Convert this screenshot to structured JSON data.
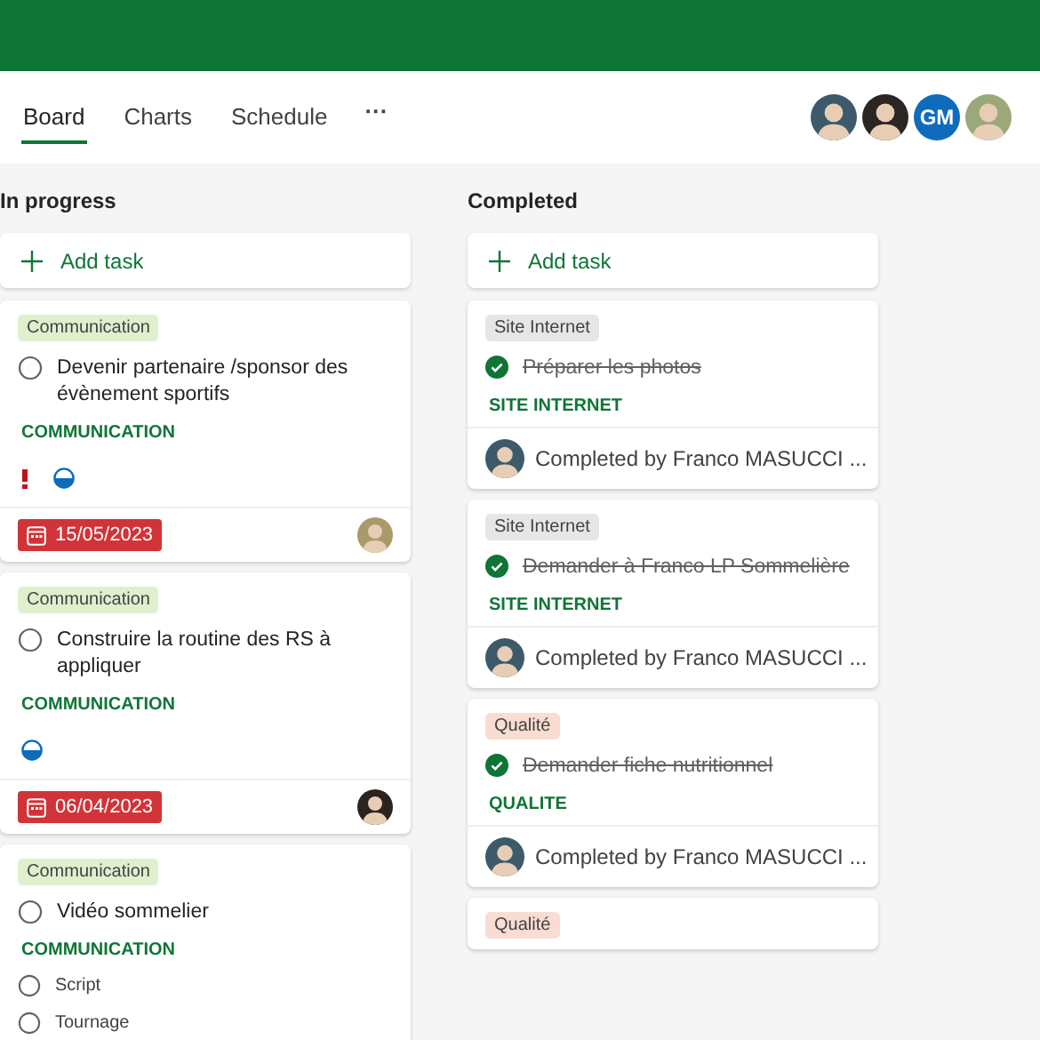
{
  "tabs": [
    {
      "label": "Board",
      "selected": true
    },
    {
      "label": "Charts",
      "selected": false
    },
    {
      "label": "Schedule",
      "selected": false
    }
  ],
  "more": "···",
  "members": [
    {
      "kind": "photo",
      "color": "#3d5a6b"
    },
    {
      "kind": "photo",
      "color": "#2b2523"
    },
    {
      "kind": "initials",
      "initials": "GM",
      "color": "#0f6cbd"
    },
    {
      "kind": "photo",
      "color": "#9aa87a"
    }
  ],
  "columns": [
    {
      "title": "In progress",
      "add_label": "Add task",
      "cards": [
        {
          "label": {
            "text": "Communication",
            "color": "#dff0cf"
          },
          "title": "Devenir partenaire /sponsor des évènement sportifs",
          "completed": false,
          "bucket": "COMMUNICATION",
          "urgent": true,
          "in_progress": true,
          "due_date": "15/05/2023",
          "overdue": true,
          "assignee": {
            "color": "#a99a6a"
          }
        },
        {
          "label": {
            "text": "Communication",
            "color": "#dff0cf"
          },
          "title": "Construire la routine des RS à appliquer",
          "completed": false,
          "bucket": "COMMUNICATION",
          "urgent": false,
          "in_progress": true,
          "due_date": "06/04/2023",
          "overdue": true,
          "assignee": {
            "color": "#2a2320"
          }
        },
        {
          "label": {
            "text": "Communication",
            "color": "#dff0cf"
          },
          "title": "Vidéo sommelier",
          "completed": false,
          "bucket": "COMMUNICATION",
          "checklist": [
            {
              "text": "Script",
              "checked": false
            },
            {
              "text": "Tournage",
              "checked": false
            }
          ]
        }
      ]
    },
    {
      "title": "Completed",
      "add_label": "Add task",
      "cards": [
        {
          "label": {
            "text": "Site Internet",
            "color": "#e6e6e6"
          },
          "title": "Préparer les photos",
          "completed": true,
          "bucket": "SITE INTERNET",
          "completed_by": "Completed by Franco MASUCCI ...",
          "assignee": {
            "color": "#3d5a6b"
          }
        },
        {
          "label": {
            "text": "Site Internet",
            "color": "#e6e6e6"
          },
          "title": "Demander à Franco LP Sommelière",
          "completed": true,
          "bucket": "SITE INTERNET",
          "completed_by": "Completed by Franco MASUCCI ...",
          "assignee": {
            "color": "#3d5a6b"
          }
        },
        {
          "label": {
            "text": "Qualité",
            "color": "#f9ddd2"
          },
          "title": "Demander fiche nutritionnel",
          "completed": true,
          "bucket": "QUALITE",
          "completed_by": "Completed by Franco MASUCCI ...",
          "assignee": {
            "color": "#3d5a6b"
          }
        },
        {
          "label": {
            "text": "Qualité",
            "color": "#f9ddd2"
          }
        }
      ]
    }
  ]
}
